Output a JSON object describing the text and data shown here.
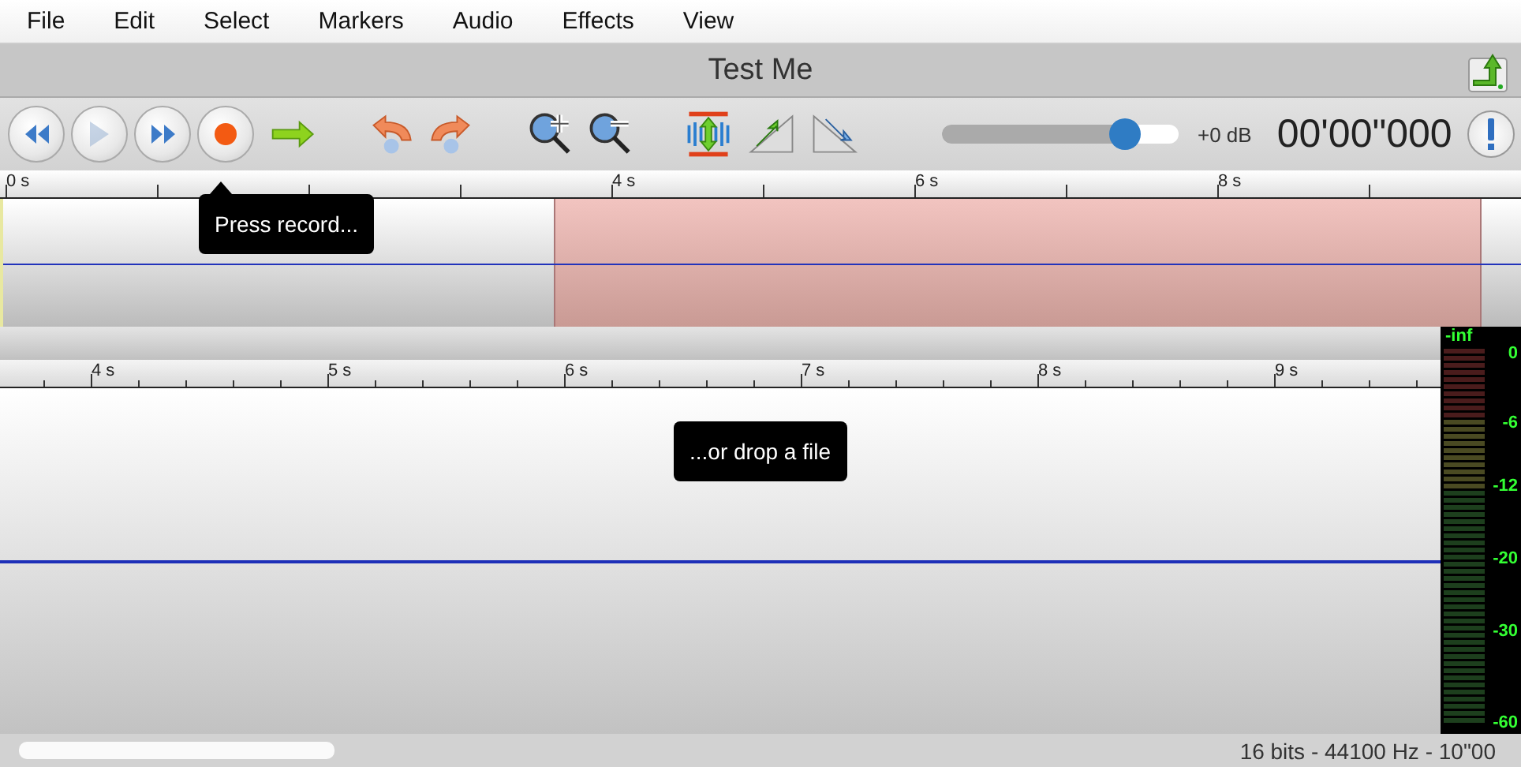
{
  "menu": [
    {
      "label": "File"
    },
    {
      "label": "Edit"
    },
    {
      "label": "Select"
    },
    {
      "label": "Markers"
    },
    {
      "label": "Audio"
    },
    {
      "label": "Effects"
    },
    {
      "label": "View"
    }
  ],
  "title": "Test Me",
  "toolbar": {
    "buttons": [
      {
        "kind": "rewind",
        "disabled": false
      },
      {
        "kind": "play",
        "disabled": true
      },
      {
        "kind": "forward",
        "disabled": false
      },
      {
        "kind": "record",
        "disabled": false
      },
      {
        "kind": "arrow",
        "disabled": false
      },
      {
        "kind": "undo",
        "disabled": false
      },
      {
        "kind": "redo",
        "disabled": false
      },
      {
        "kind": "zoom-in",
        "disabled": false
      },
      {
        "kind": "zoom-out",
        "disabled": false
      },
      {
        "kind": "fit",
        "disabled": false
      },
      {
        "kind": "fade-in",
        "disabled": false
      },
      {
        "kind": "fade-out",
        "disabled": false
      }
    ],
    "volume": {
      "level": 0.77,
      "reading": "+0 dB"
    },
    "time": "00'00\"000"
  },
  "overview": {
    "ruler": [
      "0 s",
      "4 s",
      "6 s",
      "8 s"
    ],
    "tooltip": "Press record..."
  },
  "track": {
    "ruler": [
      "4 s",
      "5 s",
      "6 s",
      "7 s",
      "8 s",
      "9 s"
    ],
    "tooltip": "...or drop a file"
  },
  "meter": {
    "peak": "-inf",
    "scale": [
      "0",
      "-6",
      "-12",
      "-20",
      "-30",
      "-60"
    ]
  },
  "status_bar": "16 bits - 44100 Hz - 10\"00"
}
